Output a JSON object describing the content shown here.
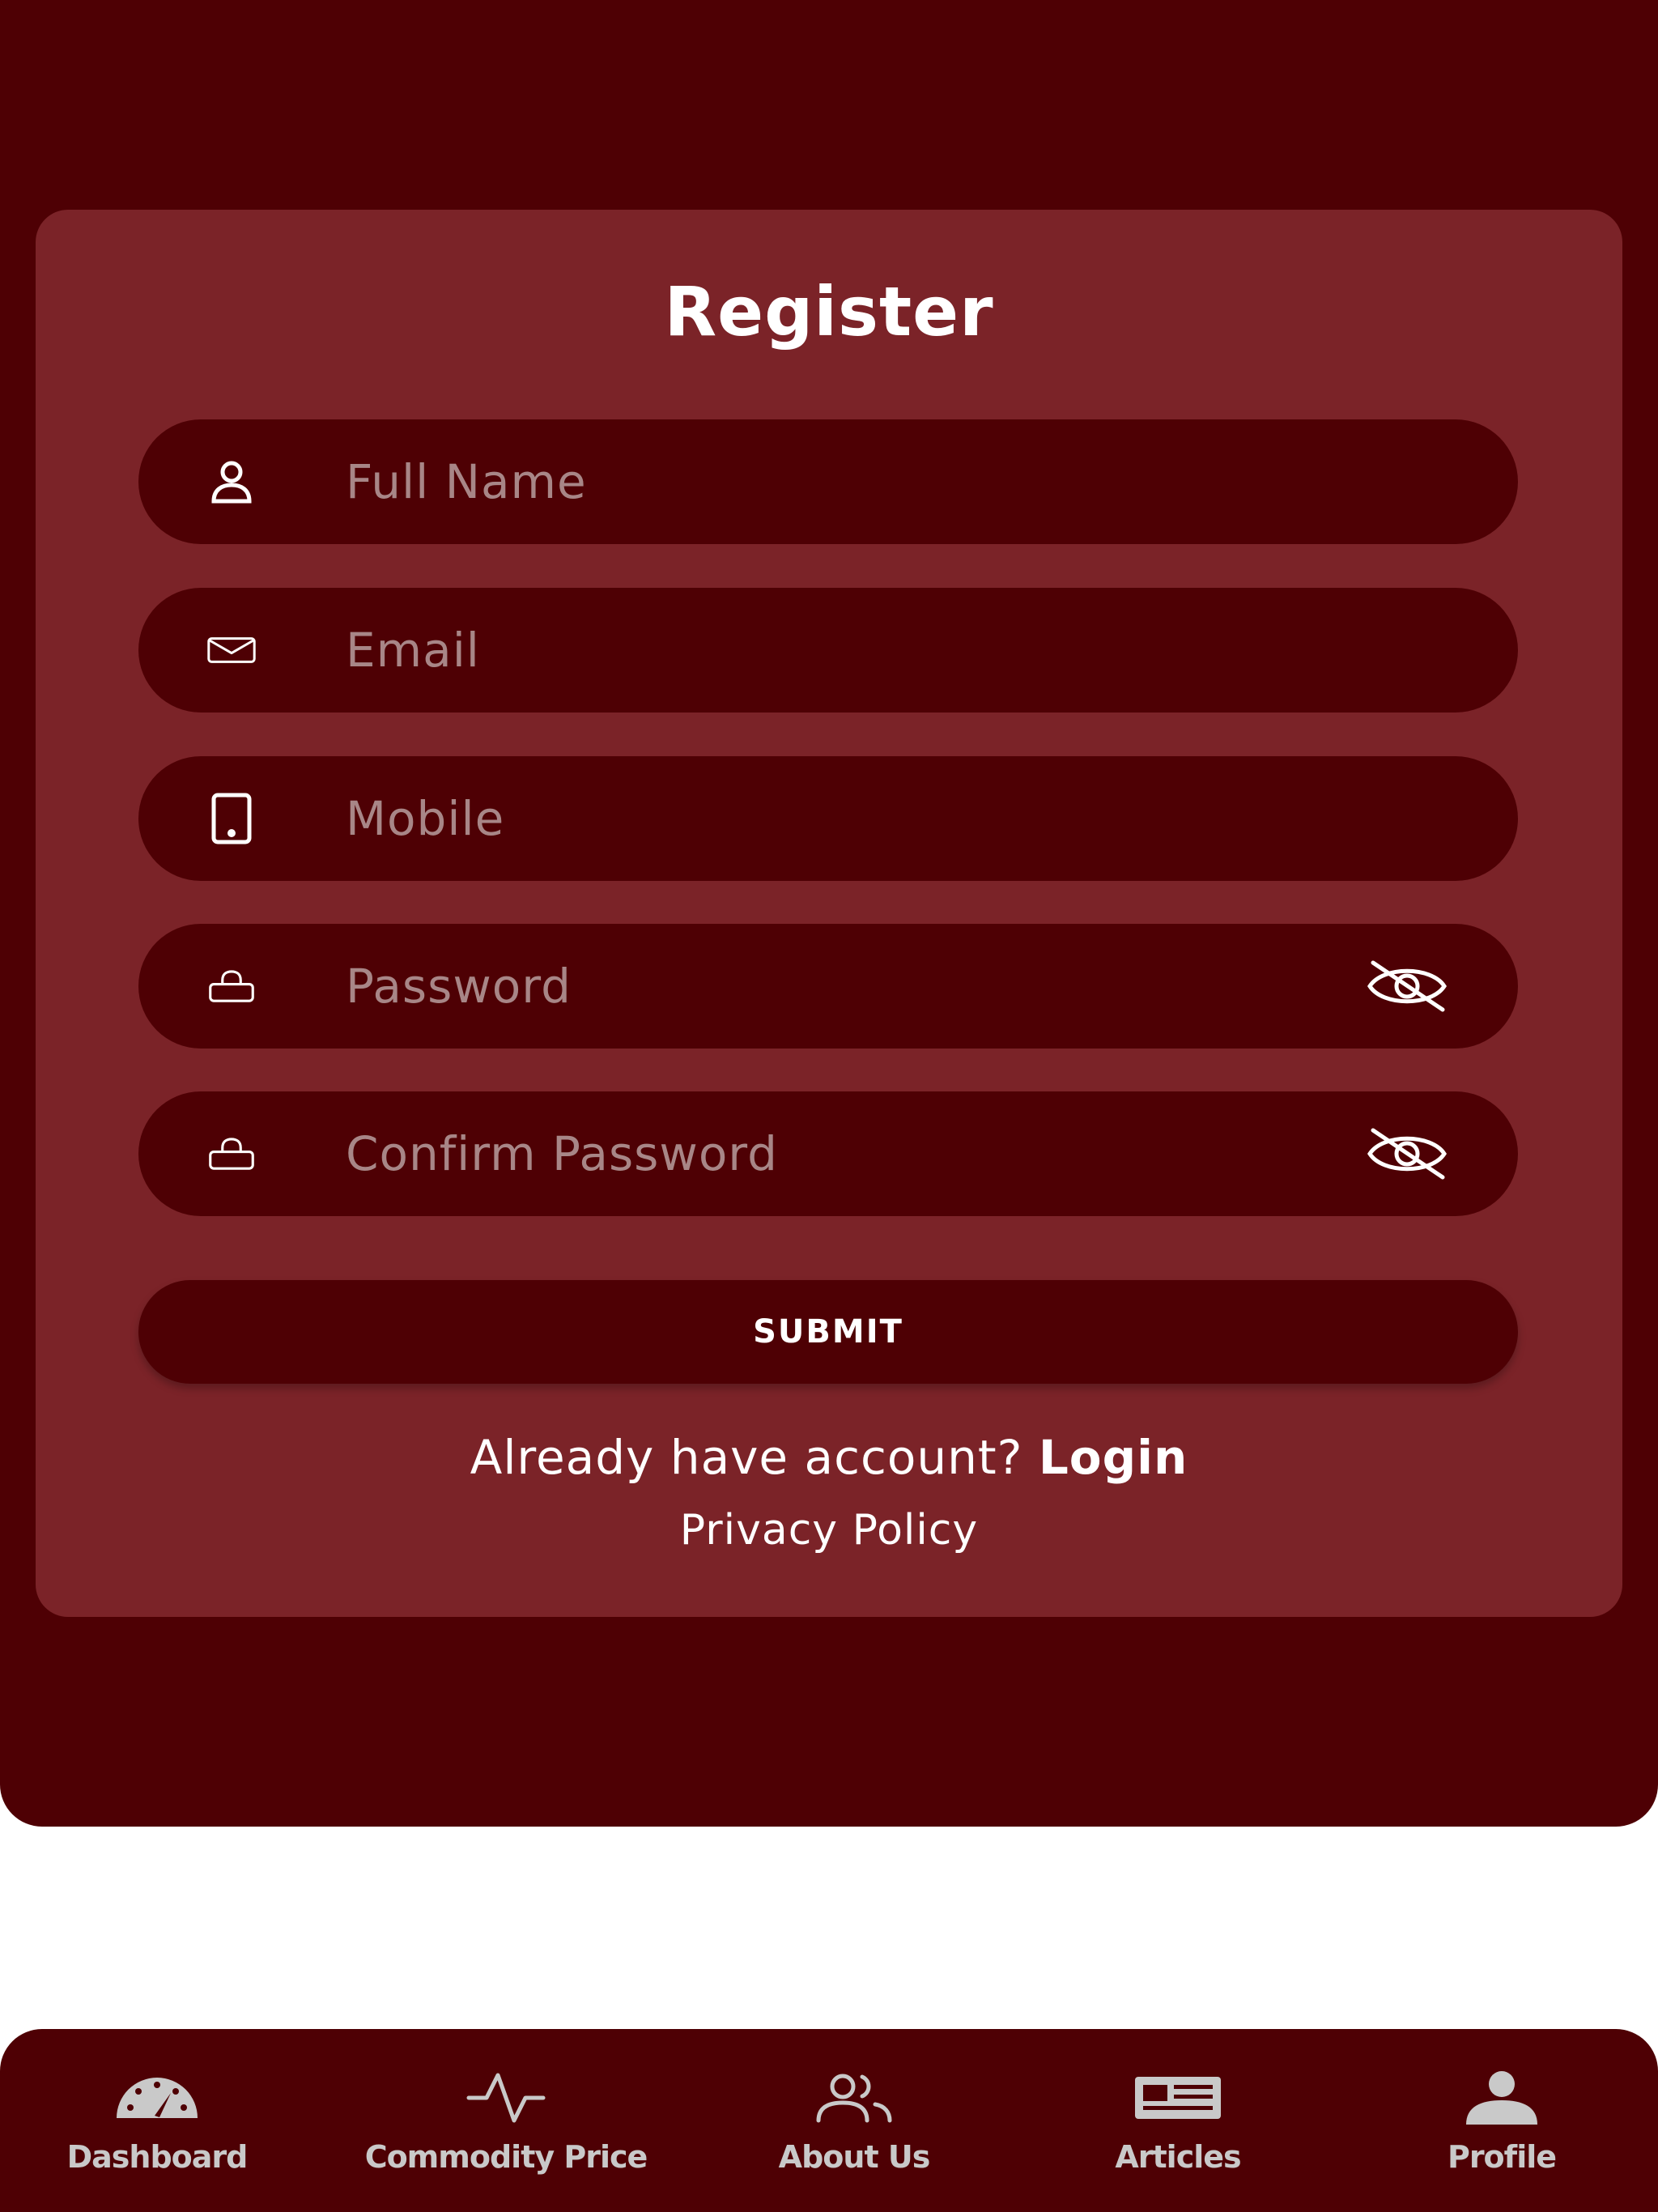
{
  "form": {
    "title": "Register",
    "fields": [
      {
        "placeholder": "Full Name",
        "icon": "user-icon"
      },
      {
        "placeholder": "Email",
        "icon": "mail-icon"
      },
      {
        "placeholder": "Mobile",
        "icon": "tablet-icon"
      },
      {
        "placeholder": "Password",
        "icon": "lock-icon",
        "toggle_icon": "eye-off-icon"
      },
      {
        "placeholder": "Confirm Password",
        "icon": "lock-icon",
        "toggle_icon": "eye-off-icon"
      }
    ],
    "submit_label": "SUBMIT",
    "already_text": "Already have account?",
    "login_label": "Login",
    "privacy_label": "Privacy Policy"
  },
  "bottom_nav": {
    "items": [
      {
        "label": "Dashboard",
        "icon": "speedometer-icon"
      },
      {
        "label": "Commodity Price",
        "icon": "activity-icon"
      },
      {
        "label": "About Us",
        "icon": "users-icon"
      },
      {
        "label": "Articles",
        "icon": "newspaper-icon"
      },
      {
        "label": "Profile",
        "icon": "person-icon"
      }
    ]
  },
  "colors": {
    "background": "#4e0004",
    "card": "#7b2328",
    "placeholder": "#a88687",
    "text": "#ffffff",
    "nav_label": "#c9c9c9"
  }
}
